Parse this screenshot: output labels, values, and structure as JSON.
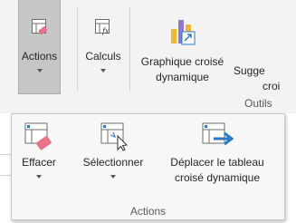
{
  "ribbon": {
    "actions_label": "Actions",
    "calculs_label": "Calculs",
    "graph_label_line1": "Graphique croisé",
    "graph_label_line2": "dynamique",
    "suggest_label_line1": "Sugge",
    "suggest_label_line2": "croi",
    "group_label": "Outils"
  },
  "actions_popup": {
    "effacer_label": "Effacer",
    "selectionner_label": "Sélectionner",
    "deplacer_line1": "Déplacer le tableau",
    "deplacer_line2": "croisé dynamique",
    "group_label": "Actions"
  },
  "colors": {
    "ribbon_bg": "#f3f3f3",
    "selected_bg": "#c6c6c6",
    "accent_blue": "#2b79c2",
    "eraser_pink": "#e8728a",
    "chart_yellow": "#f2b632",
    "chart_purple": "#8e7cc3"
  }
}
